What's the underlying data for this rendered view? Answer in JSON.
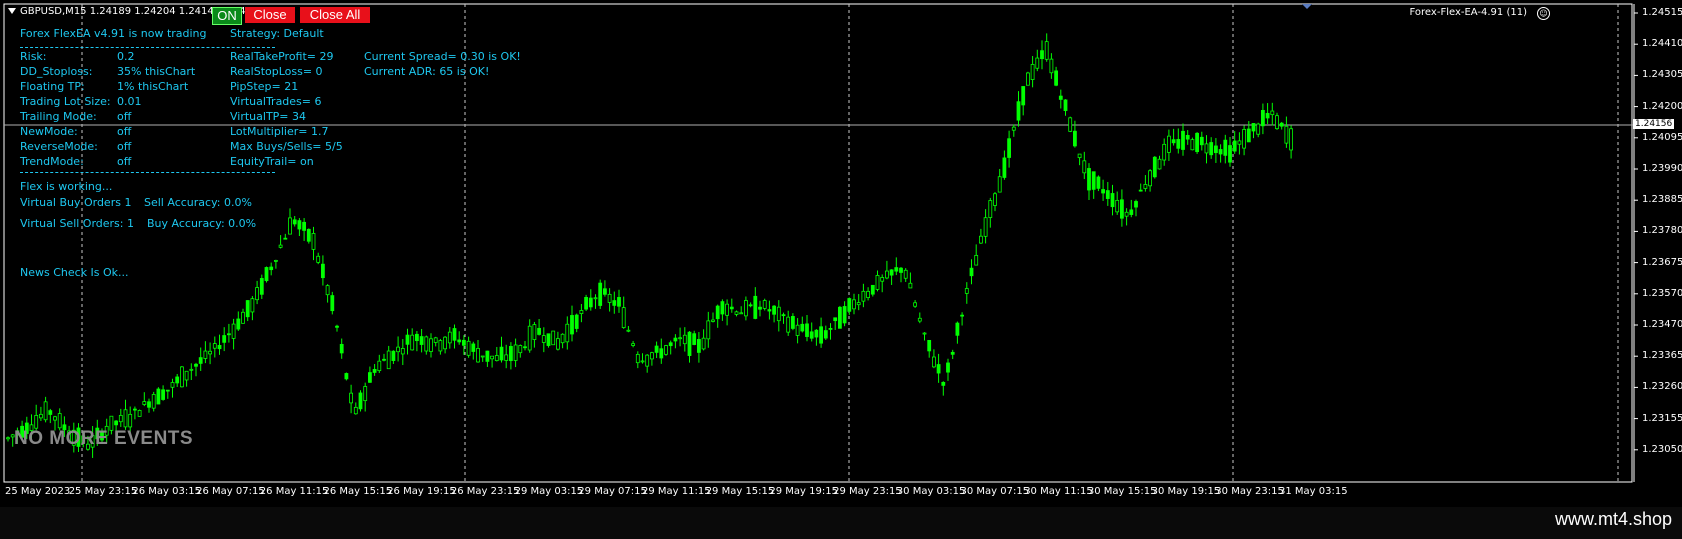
{
  "header": {
    "symbol_line": "GBPUSD,M15  1.24189 1.24204 1.24149 1.24"
  },
  "buttons": {
    "on": "ON",
    "close": "Close",
    "close_all": "Close All"
  },
  "ea_label": "Forex-Flex-EA-4.91 (11)",
  "status": {
    "line1": "Forex FlexEA v4.91 is now trading",
    "strategy": "Strategy: Default"
  },
  "settings_left": [
    {
      "label": "Risk:",
      "value": "0.2"
    },
    {
      "label": "DD_Stoploss:",
      "value": "35%  thisChart"
    },
    {
      "label": "Floating TP:",
      "value": "1%  thisChart"
    },
    {
      "label": "Trading Lot Size:",
      "value": "0.01"
    },
    {
      "label": "Trailing Mode:",
      "value": "off"
    },
    {
      "label": "NewMode:",
      "value": "off"
    },
    {
      "label": "ReverseMode:",
      "value": "off"
    },
    {
      "label": "TrendMode:",
      "value": "off"
    }
  ],
  "settings_mid": [
    "RealTakeProfit= 29",
    "RealStopLoss= 0",
    "PipStep= 21",
    "VirtualTrades= 6",
    "VirtualTP= 34",
    "LotMultiplier= 1.7",
    "Max Buys/Sells= 5/5",
    "EquityTrail= on"
  ],
  "settings_right": [
    "Current Spread= 0.30 is OK!",
    "Current ADR: 65  is OK!"
  ],
  "working": {
    "flex_working": "Flex is working...",
    "virtual_buy": "Virtual Buy Orders 1",
    "sell_accuracy": "Sell Accuracy: 0.0%",
    "virtual_sell": "Virtual Sell Orders: 1",
    "buy_accuracy": "Buy Accuracy: 0.0%",
    "news": "News Check Is Ok..."
  },
  "no_events": "NO MORE EVENTS",
  "current_price": "1.24156",
  "price_axis": [
    "1.24515",
    "1.24410",
    "1.24305",
    "1.24200",
    "1.24095",
    "1.23990",
    "1.23885",
    "1.23780",
    "1.23675",
    "1.23570",
    "1.23470",
    "1.23365",
    "1.23260",
    "1.23155",
    "1.23050"
  ],
  "time_axis": [
    "25 May 2023",
    "25 May 23:15",
    "26 May 03:15",
    "26 May 07:15",
    "26 May 11:15",
    "26 May 15:15",
    "26 May 19:15",
    "26 May 23:15",
    "29 May 03:15",
    "29 May 07:15",
    "29 May 11:15",
    "29 May 15:15",
    "29 May 19:15",
    "29 May 23:15",
    "30 May 03:15",
    "30 May 07:15",
    "30 May 11:15",
    "30 May 15:15",
    "30 May 19:15",
    "30 May 23:15",
    "31 May 03:15"
  ],
  "watermark": "www.mt4.shop",
  "colors": {
    "bg": "#000000",
    "candle": "#00ff00",
    "text_info": "#1ec8f0",
    "button_red": "#e8101a",
    "button_green": "#0a8a1a"
  },
  "chart_data": {
    "type": "candlestick",
    "price_range": [
      1.2305,
      1.2452
    ],
    "period_separators_dates": [
      "25 May 23:15",
      "26 May 23:15",
      "29 May 23:15",
      "30 May 23:15"
    ],
    "close_trace": [
      1.2318,
      1.2322,
      1.2327,
      1.232,
      1.2316,
      1.2322,
      1.2325,
      1.233,
      1.2334,
      1.234,
      1.2345,
      1.2352,
      1.236,
      1.2373,
      1.2387,
      1.238,
      1.2358,
      1.2325,
      1.234,
      1.2345,
      1.235,
      1.2348,
      1.235,
      1.2345,
      1.2343,
      1.2345,
      1.2352,
      1.2348,
      1.2356,
      1.2364,
      1.236,
      1.2343,
      1.2345,
      1.2349,
      1.2347,
      1.236,
      1.2358,
      1.236,
      1.2356,
      1.2352,
      1.235,
      1.2357,
      1.2363,
      1.2368,
      1.2372,
      1.235,
      1.2335,
      1.2362,
      1.2385,
      1.2405,
      1.243,
      1.244,
      1.242,
      1.24,
      1.2395,
      1.2388,
      1.24,
      1.241,
      1.2412,
      1.241,
      1.2408,
      1.2414,
      1.242,
      1.2412
    ]
  }
}
